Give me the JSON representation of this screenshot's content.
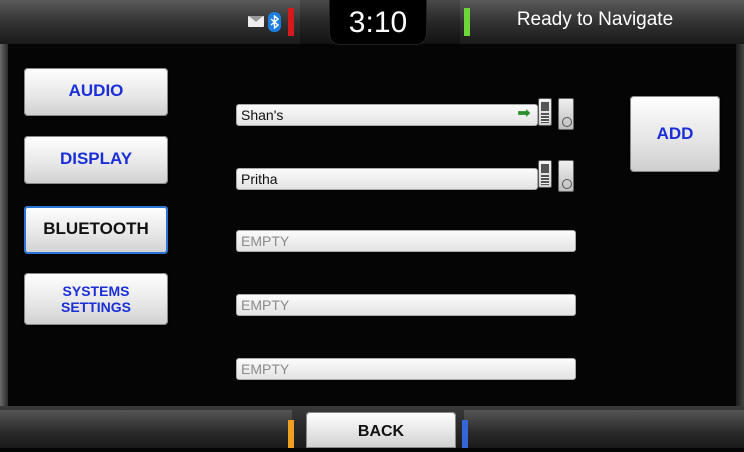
{
  "status_bar": {
    "time": "3:10",
    "status_text": "Ready to Navigate",
    "icons": [
      "mail-icon",
      "bluetooth-icon"
    ]
  },
  "menu": {
    "audio": "AUDIO",
    "display": "DISPLAY",
    "bluetooth": "BLUETOOTH",
    "systems_line1": "SYSTEMS",
    "systems_line2": "SETTINGS",
    "selected": "BLUETOOTH"
  },
  "devices": [
    {
      "name": "Shan's",
      "icons": [
        "connected-arrow-icon",
        "phone-icon",
        "media-icon"
      ]
    },
    {
      "name": "Pritha",
      "icons": [
        "phone-icon",
        "media-icon"
      ]
    },
    {
      "name": "EMPTY"
    },
    {
      "name": "EMPTY"
    },
    {
      "name": "EMPTY"
    }
  ],
  "actions": {
    "add": "ADD",
    "back": "BACK"
  },
  "colors": {
    "button_text": "#1a2fd8",
    "selected_outline": "#2a74d6",
    "indicator_red": "#d41a1a",
    "indicator_green": "#6ed63a",
    "indicator_orange": "#f0a020",
    "indicator_blue": "#3466d8"
  }
}
